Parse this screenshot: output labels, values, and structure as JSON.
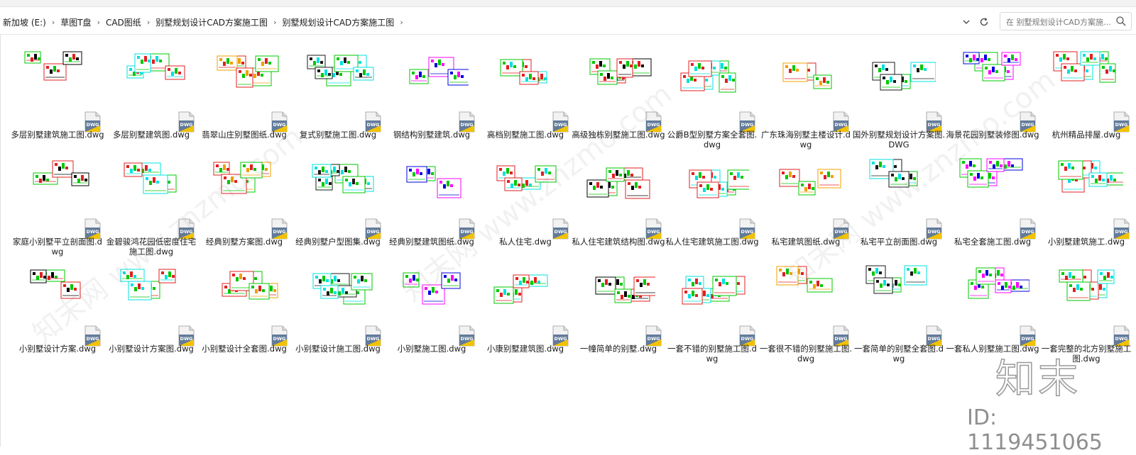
{
  "breadcrumb": [
    "新加坡 (E:)",
    "草图T盘",
    "CAD图纸",
    "别墅规划设计CAD方案施工图",
    "别墅规划设计CAD方案施工图"
  ],
  "search": {
    "placeholder": "在 别墅规划设计CAD方案施..."
  },
  "icons": {
    "dropdown": "chevron-down-icon",
    "refresh": "refresh-icon",
    "search": "search-icon",
    "file": "dwg-file-icon"
  },
  "colors": {
    "dwg_yellow": "#f2c200",
    "dwg_blue": "#4a6fb5",
    "cad_green": "#00c800",
    "cad_cyan": "#00e0e0",
    "cad_red": "#e02020"
  },
  "files": [
    {
      "name": "多层别墅建筑施工图.dwg"
    },
    {
      "name": "多层别墅建筑图.dwg"
    },
    {
      "name": "翡翠山庄别墅图纸.dwg"
    },
    {
      "name": "复式别墅施工图.dwg"
    },
    {
      "name": "钢结构别墅建筑.dwg"
    },
    {
      "name": "高档别墅施工图.dwg"
    },
    {
      "name": "高级独栋别墅施工图.dwg"
    },
    {
      "name": "公爵B型别墅方案全套图.dwg"
    },
    {
      "name": "广东珠海别墅主楼设计.dwg"
    },
    {
      "name": "国外别墅规划设计方案图.DWG"
    },
    {
      "name": "海景花园别墅装修图.dwg"
    },
    {
      "name": "杭州精品排屋.dwg"
    },
    {
      "name": "家庭小别墅平立剖面图.dwg"
    },
    {
      "name": "金碧骏鸿花园低密度住宅施工图.dwg"
    },
    {
      "name": "经典别墅方案图.dwg"
    },
    {
      "name": "经典别墅户型图集.dwg"
    },
    {
      "name": "经典别墅建筑图纸.dwg"
    },
    {
      "name": "私人住宅.dwg"
    },
    {
      "name": "私人住宅建筑结构图.dwg"
    },
    {
      "name": "私人住宅建筑施工图.dwg"
    },
    {
      "name": "私宅建筑图纸.dwg"
    },
    {
      "name": "私宅平立剖面图.dwg"
    },
    {
      "name": "私宅全套施工图.dwg"
    },
    {
      "name": "小别墅建筑施工.dwg"
    },
    {
      "name": "小别墅设计方案.dwg"
    },
    {
      "name": "小别墅设计方案图.dwg"
    },
    {
      "name": "小别墅设计全套图.dwg"
    },
    {
      "name": "小别墅设计施工图.dwg"
    },
    {
      "name": "小别墅施工图.dwg"
    },
    {
      "name": "小康别墅建筑图.dwg"
    },
    {
      "name": "一幢简单的别墅.dwg"
    },
    {
      "name": "一套不错的别墅施工图.dwg"
    },
    {
      "name": "一套很不错的别墅施工图.dwg"
    },
    {
      "name": "一套简单的别墅全套图.dwg"
    },
    {
      "name": "一套私人别墅施工图.dwg"
    },
    {
      "name": "一套完整的北方别墅施工图.dwg"
    }
  ],
  "watermark": {
    "logo": "知末",
    "id": "ID: 1119451065"
  }
}
